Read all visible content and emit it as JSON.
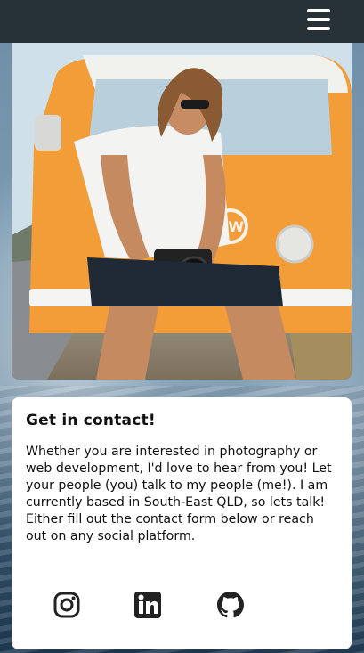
{
  "nav": {
    "menu_icon": "hamburger-menu-icon"
  },
  "hero": {
    "image_icon": "profile-photo"
  },
  "contact": {
    "title": "Get in contact!",
    "text": "Whether you are interested in photography or web development, I'd love to hear from you! Let your people (you) talk to my people (me!). I am currently based in South-East QLD, so lets talk! Either fill out the contact form below or reach out on any social platform."
  },
  "socials": [
    {
      "name": "instagram-icon"
    },
    {
      "name": "linkedin-icon"
    },
    {
      "name": "github-icon"
    }
  ],
  "colors": {
    "navbar": "#263238",
    "card": "#ffffff",
    "text": "#111111",
    "accent": "#f29d38"
  }
}
